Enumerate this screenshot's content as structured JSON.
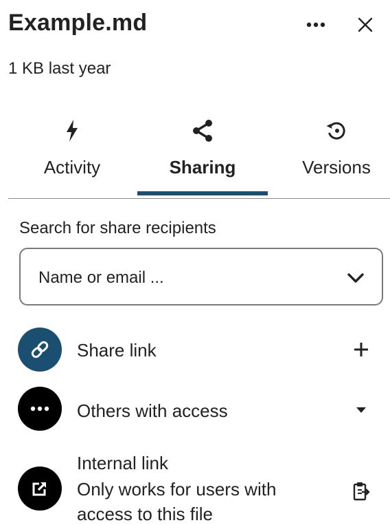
{
  "header": {
    "title": "Example.md",
    "subtitle": "1 KB last year",
    "more_icon": "more-horizontal-icon",
    "close_icon": "close-icon"
  },
  "tabs": [
    {
      "label": "Activity",
      "icon": "lightning-icon",
      "active": false
    },
    {
      "label": "Sharing",
      "icon": "share-icon",
      "active": true
    },
    {
      "label": "Versions",
      "icon": "history-icon",
      "active": false
    }
  ],
  "search": {
    "label": "Search for share recipients",
    "placeholder": "Name or email ...",
    "dropdown_icon": "chevron-down-icon"
  },
  "share_rows": [
    {
      "label": "Share link",
      "avatar_icon": "link-icon",
      "action_icon": "plus-icon"
    },
    {
      "label": "Others with access",
      "avatar_icon": "more-horizontal-icon",
      "action_icon": "caret-down-icon"
    },
    {
      "title": "Internal link",
      "description_line1": "Only works for users with",
      "description_line2": "access to this file",
      "avatar_icon": "external-link-icon",
      "action_icon": "clipboard-icon"
    }
  ],
  "colors": {
    "accent": "#1a4f72",
    "text": "#222222",
    "border": "#7a7a7a"
  }
}
